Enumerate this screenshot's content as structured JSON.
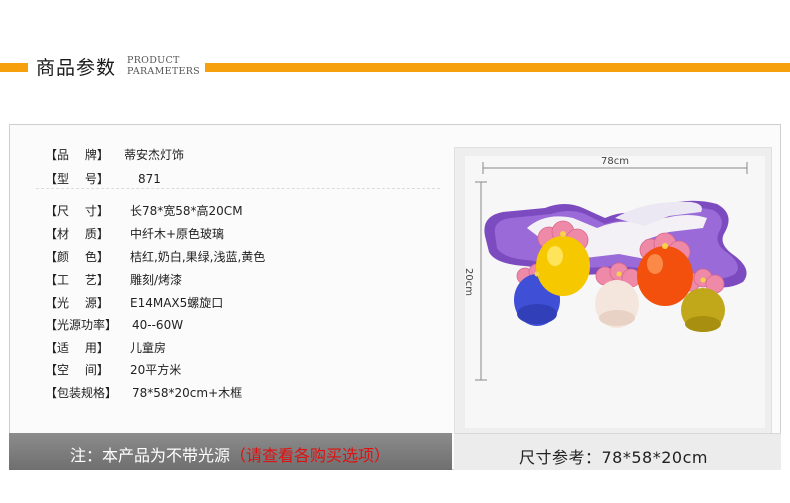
{
  "header": {
    "title": "商品参数",
    "en_line1": "PRODUCT",
    "en_line2": "PARAMETERS",
    "accent_color": "#f5a00c"
  },
  "specs_top": [
    {
      "label": "【品　 牌】",
      "value": "蒂安杰灯饰"
    },
    {
      "label": "【型　 号】",
      "value": "871"
    }
  ],
  "specs": [
    {
      "label": "【尺　  寸】",
      "value": "长78*宽58*高20CM"
    },
    {
      "label": "【材　  质】",
      "value": "中纤木+原色玻璃"
    },
    {
      "label": "【颜　  色】",
      "value": "桔红,奶白,果绿,浅蓝,黄色"
    },
    {
      "label": "【工　  艺】",
      "value": "雕刻/烤漆"
    },
    {
      "label": "【光　  源】",
      "value": "E14MAX5螺旋口"
    },
    {
      "label": "【光源功率】",
      "value": "40--60W"
    },
    {
      "label": "【适　  用】",
      "value": "儿童房"
    },
    {
      "label": "【空　  间】",
      "value": "20平方米"
    },
    {
      "label": "【包装规格】",
      "value": "78*58*20cm+木框"
    }
  ],
  "photo": {
    "width_label": "78cm",
    "height_label": "20cm",
    "colors": {
      "purple": "#8a55c8",
      "orange": "#f2500c",
      "yellow": "#f6c800",
      "blue": "#4050d8",
      "white": "#f4e8e0",
      "olive": "#c0a81a",
      "pink": "#ee8aa8"
    }
  },
  "note": {
    "text": "注：本产品为不带光源",
    "highlight": "（请查看各购买选项）",
    "highlight_color": "#e01010"
  },
  "size_ref": {
    "text": "尺寸参考：78*58*20cm"
  }
}
